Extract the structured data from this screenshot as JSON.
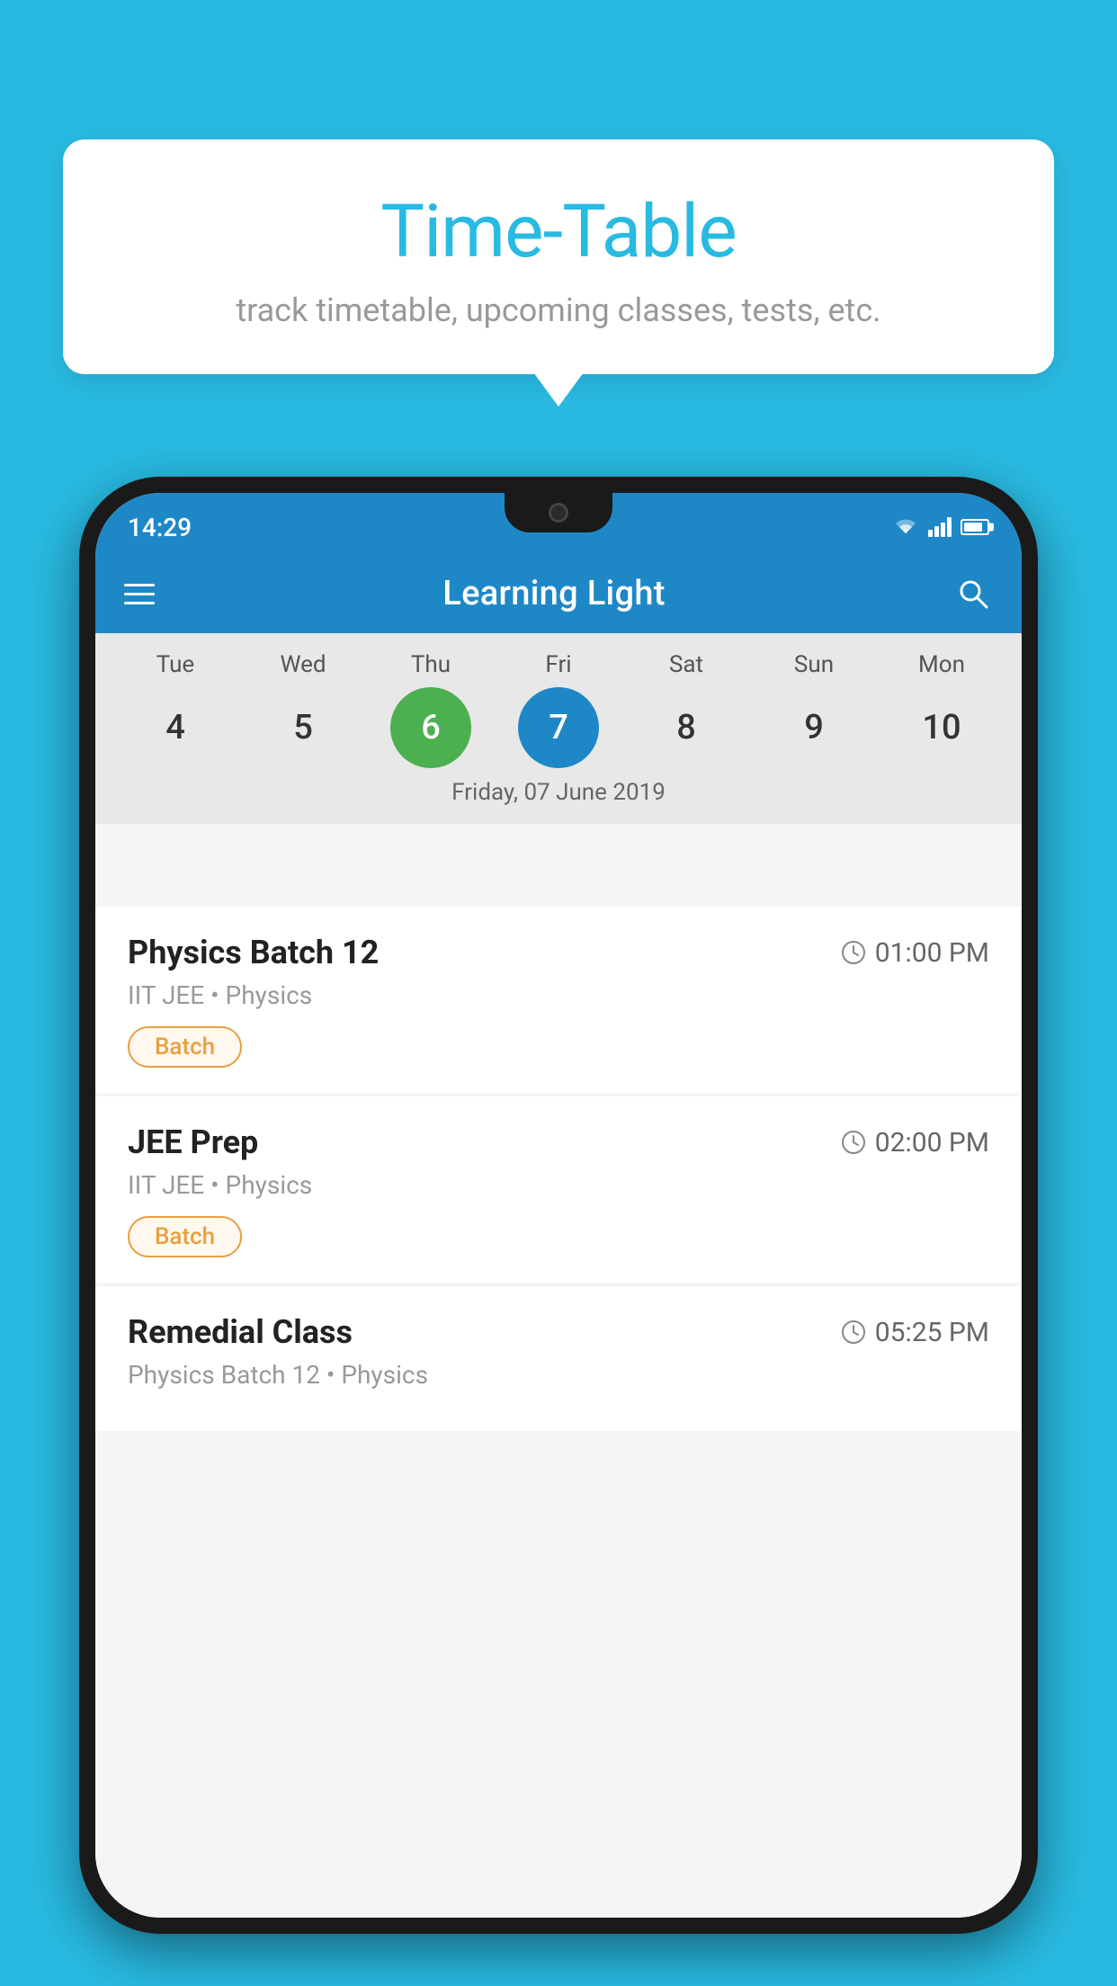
{
  "background_color": "#29BAE2",
  "tooltip": {
    "title": "Time-Table",
    "subtitle": "track timetable, upcoming classes, tests, etc."
  },
  "status_bar": {
    "time": "14:29"
  },
  "app_bar": {
    "title": "Learning Light",
    "hamburger_label": "menu",
    "search_label": "search"
  },
  "calendar": {
    "days": [
      {
        "label": "Tue",
        "num": "4",
        "state": "normal"
      },
      {
        "label": "Wed",
        "num": "5",
        "state": "normal"
      },
      {
        "label": "Thu",
        "num": "6",
        "state": "today-green"
      },
      {
        "label": "Fri",
        "num": "7",
        "state": "selected-blue"
      },
      {
        "label": "Sat",
        "num": "8",
        "state": "normal"
      },
      {
        "label": "Sun",
        "num": "9",
        "state": "normal"
      },
      {
        "label": "Mon",
        "num": "10",
        "state": "normal"
      }
    ],
    "selected_date_label": "Friday, 07 June 2019"
  },
  "schedule": [
    {
      "title": "Physics Batch 12",
      "time": "01:00 PM",
      "sub": "IIT JEE • Physics",
      "badge": "Batch"
    },
    {
      "title": "JEE Prep",
      "time": "02:00 PM",
      "sub": "IIT JEE • Physics",
      "badge": "Batch"
    },
    {
      "title": "Remedial Class",
      "time": "05:25 PM",
      "sub": "Physics Batch 12 • Physics",
      "badge": ""
    }
  ]
}
